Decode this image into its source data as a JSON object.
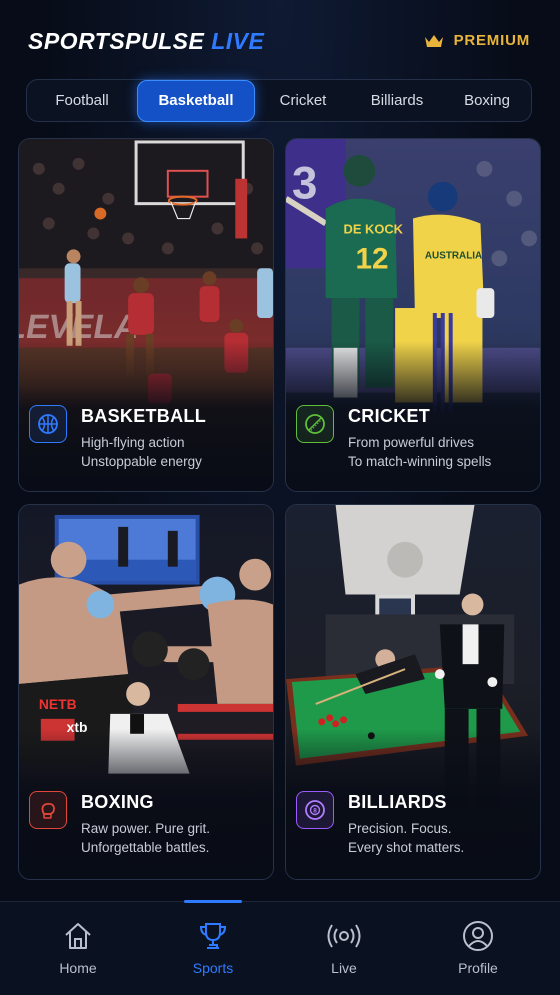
{
  "header": {
    "logo_main": "SPORTSPULSE",
    "logo_accent": "LIVE",
    "premium_label": "PREMIUM",
    "premium_icon": "crown-icon"
  },
  "tabs": [
    {
      "label": "Football"
    },
    {
      "label": "Basketball",
      "active": true
    },
    {
      "label": "Cricket"
    },
    {
      "label": "Billiards"
    },
    {
      "label": "Boxing"
    }
  ],
  "cards": [
    {
      "title": "BASKETBALL",
      "line1": "High-flying action",
      "line2": "Unstoppable energy",
      "icon": "basketball-icon",
      "color": "#2f7bff"
    },
    {
      "title": "CRICKET",
      "line1": "From powerful drives",
      "line2": "To match-winning spells",
      "icon": "cricket-ball-icon",
      "color": "#5fbf3a"
    },
    {
      "title": "BOXING",
      "line1": "Raw power. Pure grit.",
      "line2": "Unforgettable battles.",
      "icon": "boxing-glove-icon",
      "color": "#e0473a"
    },
    {
      "title": "BILLIARDS",
      "line1": "Precision. Focus.",
      "line2": "Every shot matters.",
      "icon": "eight-ball-icon",
      "color": "#9a5cff"
    }
  ],
  "nav": [
    {
      "label": "Home",
      "icon": "home-icon"
    },
    {
      "label": "Sports",
      "icon": "trophy-icon",
      "active": true
    },
    {
      "label": "Live",
      "icon": "live-broadcast-icon"
    },
    {
      "label": "Profile",
      "icon": "profile-icon"
    }
  ],
  "colors": {
    "accent": "#2f7bff",
    "premium": "#e9b43c",
    "background": "#070c18"
  }
}
